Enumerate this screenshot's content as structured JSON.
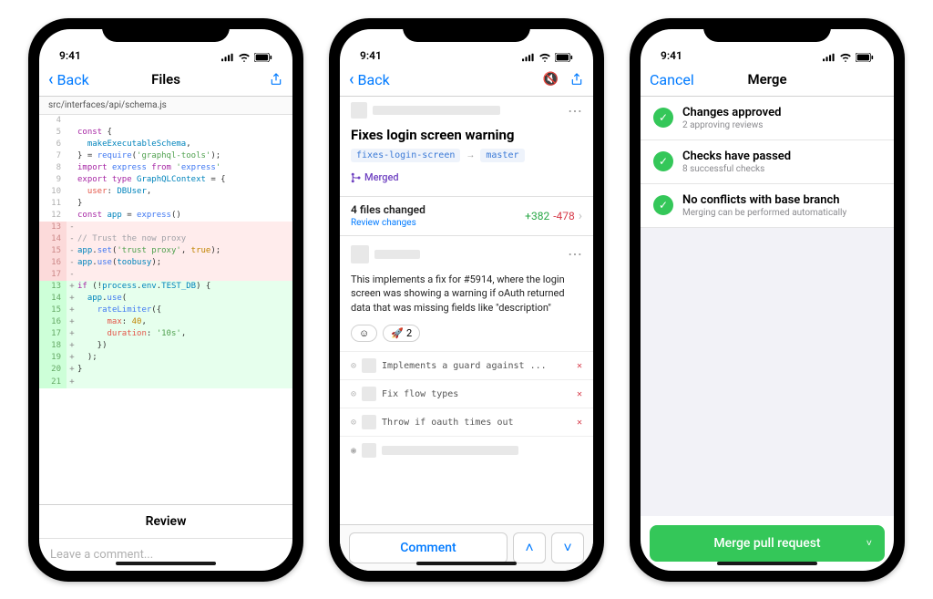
{
  "status_bar": {
    "time": "9:41"
  },
  "screen1": {
    "nav": {
      "back": "Back",
      "title": "Files"
    },
    "filepath": "src/interfaces/api/schema.js",
    "code": [
      {
        "n": "4",
        "t": "  ",
        "cls": ""
      },
      {
        "n": "5",
        "t": "const {",
        "cls": ""
      },
      {
        "n": "6",
        "t": "  makeExecutableSchema,",
        "cls": ""
      },
      {
        "n": "7",
        "t": "} = require('graphql-tools');",
        "cls": ""
      },
      {
        "n": "8",
        "t": "import express from 'express'",
        "cls": ""
      },
      {
        "n": "9",
        "t": "export type GraphQLContext = {",
        "cls": ""
      },
      {
        "n": "10",
        "t": "  user: DBUser,",
        "cls": ""
      },
      {
        "n": "11",
        "t": "}",
        "cls": ""
      },
      {
        "n": "12",
        "t": "const app = express()",
        "cls": ""
      },
      {
        "n": "13",
        "s": "-",
        "t": "",
        "cls": "del"
      },
      {
        "n": "14",
        "s": "-",
        "t": "// Trust the now proxy",
        "cls": "del"
      },
      {
        "n": "15",
        "s": "-",
        "t": "app.set('trust proxy', true);",
        "cls": "del"
      },
      {
        "n": "16",
        "s": "-",
        "t": "app.use(toobusy);",
        "cls": "del"
      },
      {
        "n": "17",
        "s": "-",
        "t": "",
        "cls": "del"
      },
      {
        "n": "13",
        "s": "+",
        "t": "if (!process.env.TEST_DB) {",
        "cls": "add"
      },
      {
        "n": "14",
        "s": "+",
        "t": "  app.use(",
        "cls": "add"
      },
      {
        "n": "15",
        "s": "+",
        "t": "    rateLimiter({",
        "cls": "add"
      },
      {
        "n": "16",
        "s": "+",
        "t": "      max: 40,",
        "cls": "add"
      },
      {
        "n": "17",
        "s": "+",
        "t": "      duration: '10s',",
        "cls": "add"
      },
      {
        "n": "18",
        "s": "+",
        "t": "    })",
        "cls": "add"
      },
      {
        "n": "19",
        "s": "+",
        "t": "  );",
        "cls": "add"
      },
      {
        "n": "20",
        "s": "+",
        "t": "}",
        "cls": "add"
      },
      {
        "n": "21",
        "s": "+",
        "t": "",
        "cls": "add"
      }
    ],
    "review_label": "Review",
    "comment_placeholder": "Leave a comment..."
  },
  "screen2": {
    "nav": {
      "back": "Back"
    },
    "pr_title": "Fixes login screen warning",
    "branch_from": "fixes-login-screen",
    "branch_to": "master",
    "merged_label": "Merged",
    "files_changed": "4 files changed",
    "review_link": "Review changes",
    "additions": "+382",
    "deletions": "-478",
    "comment_body": "This implements a fix for #5914, where the login screen was showing a warning if oAuth returned data that was missing fields like \"description\"",
    "rocket_count": "2",
    "commits": [
      {
        "msg": "Implements a guard against ...",
        "status": "x"
      },
      {
        "msg": "Fix flow types",
        "status": "x"
      },
      {
        "msg": "Throw if oauth times out",
        "status": "x"
      },
      {
        "msg": "",
        "status": "eye"
      }
    ],
    "comment_btn": "Comment"
  },
  "screen3": {
    "nav": {
      "cancel": "Cancel",
      "title": "Merge"
    },
    "checks": [
      {
        "title": "Changes approved",
        "sub": "2 approving reviews"
      },
      {
        "title": "Checks have passed",
        "sub": "8 successful checks"
      },
      {
        "title": "No conflicts with base branch",
        "sub": "Merging can be performed automatically"
      }
    ],
    "merge_btn": "Merge pull request"
  }
}
